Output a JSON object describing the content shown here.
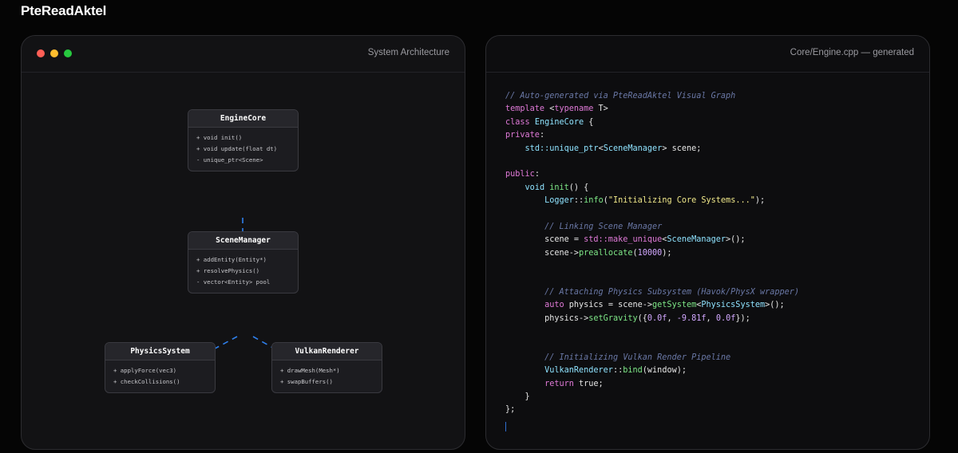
{
  "app": {
    "brand": "PteReadAktel"
  },
  "left_panel": {
    "title": "System Architecture",
    "classes": [
      {
        "name": "EngineCore",
        "members": [
          "+ void init()",
          "+ void update(float dt)",
          "- unique_ptr<Scene>"
        ]
      },
      {
        "name": "SceneManager",
        "members": [
          "+ addEntity(Entity*)",
          "+ resolvePhysics()",
          "- vector<Entity> pool"
        ]
      },
      {
        "name": "PhysicsSystem",
        "members": [
          "+ applyForce(vec3)",
          "+ checkCollisions()"
        ]
      },
      {
        "name": "VulkanRenderer",
        "members": [
          "+ drawMesh(Mesh*)",
          "+ swapBuffers()"
        ]
      }
    ],
    "edges": [
      {
        "from": "EngineCore",
        "to": "SceneManager",
        "style": "dashed"
      },
      {
        "from": "SceneManager",
        "to": "PhysicsSystem",
        "style": "dashed"
      },
      {
        "from": "SceneManager",
        "to": "VulkanRenderer",
        "style": "dashed"
      }
    ],
    "edge_color": "#2f80ed"
  },
  "right_panel": {
    "title": "Core/Engine.cpp — generated",
    "code_lines": [
      [
        [
          "c",
          "// Auto-generated via PteReadAktel Visual Graph"
        ]
      ],
      [
        [
          "k",
          "template "
        ],
        [
          "p",
          "<"
        ],
        [
          "k",
          "typename "
        ],
        [
          "p",
          "T>"
        ]
      ],
      [
        [
          "k",
          "class "
        ],
        [
          "t",
          "EngineCore "
        ],
        [
          "p",
          "{"
        ]
      ],
      [
        [
          "k",
          "private"
        ],
        [
          "p",
          ":"
        ]
      ],
      [
        [
          "p",
          "    "
        ],
        [
          "t",
          "std::unique_ptr"
        ],
        [
          "p",
          "<"
        ],
        [
          "t",
          "SceneManager"
        ],
        [
          "p",
          "> scene;"
        ]
      ],
      [],
      [
        [
          "k",
          "public"
        ],
        [
          "p",
          ":"
        ]
      ],
      [
        [
          "p",
          "    "
        ],
        [
          "t",
          "void "
        ],
        [
          "f",
          "init"
        ],
        [
          "p",
          "() {"
        ]
      ],
      [
        [
          "p",
          "        "
        ],
        [
          "t",
          "Logger"
        ],
        [
          "p",
          "::"
        ],
        [
          "f",
          "info"
        ],
        [
          "p",
          "("
        ],
        [
          "s",
          "\"Initializing Core Systems...\""
        ],
        [
          "p",
          ");"
        ]
      ],
      [],
      [
        [
          "p",
          "        "
        ],
        [
          "c",
          "// Linking Scene Manager"
        ]
      ],
      [
        [
          "p",
          "        scene = "
        ],
        [
          "k",
          "std::make_unique"
        ],
        [
          "p",
          "<"
        ],
        [
          "t",
          "SceneManager"
        ],
        [
          "p",
          ">();"
        ]
      ],
      [
        [
          "p",
          "        scene->"
        ],
        [
          "f",
          "preallocate"
        ],
        [
          "p",
          "("
        ],
        [
          "n",
          "10000"
        ],
        [
          "p",
          ");"
        ]
      ],
      [],
      [],
      [
        [
          "p",
          "        "
        ],
        [
          "c",
          "// Attaching Physics Subsystem (Havok/PhysX wrapper)"
        ]
      ],
      [
        [
          "p",
          "        "
        ],
        [
          "k",
          "auto "
        ],
        [
          "p",
          "physics = scene->"
        ],
        [
          "f",
          "getSystem"
        ],
        [
          "p",
          "<"
        ],
        [
          "t",
          "PhysicsSystem"
        ],
        [
          "p",
          ">();"
        ]
      ],
      [
        [
          "p",
          "        physics->"
        ],
        [
          "f",
          "setGravity"
        ],
        [
          "p",
          "({"
        ],
        [
          "n",
          "0.0f"
        ],
        [
          "p",
          ", "
        ],
        [
          "n",
          "-9.81f"
        ],
        [
          "p",
          ", "
        ],
        [
          "n",
          "0.0f"
        ],
        [
          "p",
          "});"
        ]
      ],
      [],
      [],
      [
        [
          "p",
          "        "
        ],
        [
          "c",
          "// Initializing Vulkan Render Pipeline"
        ]
      ],
      [
        [
          "p",
          "        "
        ],
        [
          "t",
          "VulkanRenderer"
        ],
        [
          "p",
          "::"
        ],
        [
          "f",
          "bind"
        ],
        [
          "p",
          "(window);"
        ]
      ],
      [
        [
          "p",
          "        "
        ],
        [
          "k",
          "return "
        ],
        [
          "p",
          "true;"
        ]
      ],
      [
        [
          "p",
          "    }"
        ]
      ],
      [
        [
          "p",
          "};"
        ]
      ]
    ]
  }
}
